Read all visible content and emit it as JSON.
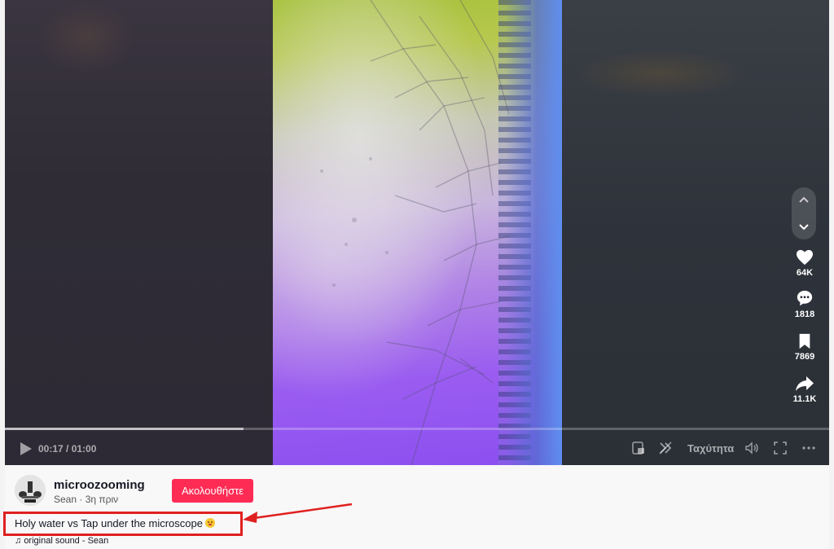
{
  "player": {
    "time": "00:17 / 01:00",
    "progress": 0.29,
    "speed_label": "Ταχύτητα",
    "icons": [
      "play-icon",
      "pip-icon",
      "autoscroll-icon",
      "volume-icon",
      "fullscreen-icon",
      "more-icon"
    ]
  },
  "sidebar": {
    "likes": "64K",
    "comments": "1818",
    "favorites": "7869",
    "shares": "11.1K"
  },
  "author": {
    "username": "microozooming",
    "subtitle": "Sean · 3η πριν",
    "follow_label": "Ακολουθήστε"
  },
  "caption": {
    "text": "Holy water vs Tap under the microscope"
  },
  "music": {
    "text": "original sound - Sean"
  },
  "annotation": {
    "highlight_color": "#e02020"
  }
}
